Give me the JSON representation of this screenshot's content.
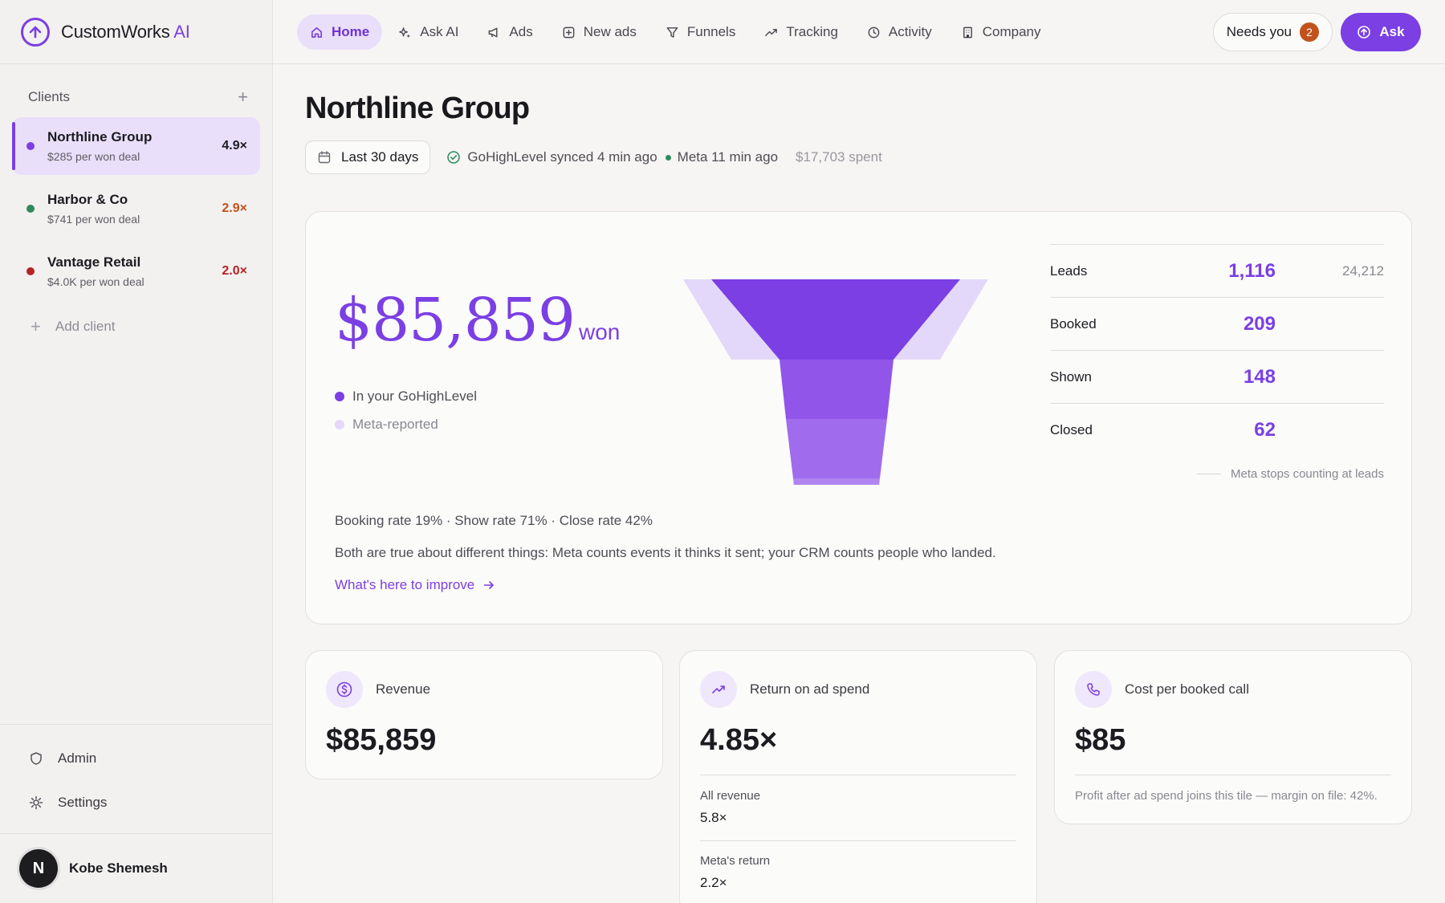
{
  "brand": {
    "name": "CustomWorks",
    "suffix": "AI"
  },
  "nav": {
    "items": [
      {
        "label": "Home",
        "icon": "home-icon",
        "active": true
      },
      {
        "label": "Ask AI",
        "icon": "sparkle-icon"
      },
      {
        "label": "Ads",
        "icon": "megaphone-icon"
      },
      {
        "label": "New ads",
        "icon": "plus-square-icon"
      },
      {
        "label": "Funnels",
        "icon": "filter-icon"
      },
      {
        "label": "Tracking",
        "icon": "trend-icon"
      },
      {
        "label": "Activity",
        "icon": "clock-icon"
      },
      {
        "label": "Company",
        "icon": "building-icon"
      }
    ],
    "needs_label": "Needs you",
    "needs_count": "2",
    "ask_label": "Ask"
  },
  "sidebar": {
    "clients_title": "Clients",
    "clients": [
      {
        "name": "Northline Group",
        "sub": "$285 per won deal",
        "ratio": "4.9×",
        "dot_color": "#7b3fe4",
        "ratio_color": "#1c1b20",
        "active": true
      },
      {
        "name": "Harbor & Co",
        "sub": "$741 per won deal",
        "ratio": "2.9×",
        "dot_color": "#2f8a5d",
        "ratio_color": "#c2521b"
      },
      {
        "name": "Vantage Retail",
        "sub": "$4.0K per won deal",
        "ratio": "2.0×",
        "dot_color": "#b42323",
        "ratio_color": "#b42323"
      }
    ],
    "add_client": "Add client",
    "admin": "Admin",
    "settings": "Settings",
    "user_initial": "N",
    "user_name": "Kobe Shemesh"
  },
  "page": {
    "title": "Northline Group",
    "range": "Last 30 days",
    "sync_ghl": "GoHighLevel synced 4 min ago",
    "sync_meta": "Meta 11 min ago",
    "spent": "$17,703 spent"
  },
  "hero": {
    "won_amount": "$85,859",
    "won_label": "won",
    "legend_ghl": "In your GoHighLevel",
    "legend_meta": "Meta-reported",
    "stats": [
      {
        "label": "Leads",
        "value": "1,116",
        "meta": "24,212"
      },
      {
        "label": "Booked",
        "value": "209",
        "meta": ""
      },
      {
        "label": "Shown",
        "value": "148",
        "meta": ""
      },
      {
        "label": "Closed",
        "value": "62",
        "meta": ""
      }
    ],
    "stats_note": "Meta stops counting at leads",
    "rates": "Booking rate 19% · Show rate 71% · Close rate 42%",
    "explain": "Both are true about different things: Meta counts events it thinks it sent; your CRM counts people who landed.",
    "improve": "What's here to improve",
    "funnel": {
      "leads": 1116,
      "booked": 209,
      "shown": 148,
      "closed": 62,
      "meta_leads": 24212
    },
    "colors": {
      "accent": "#7b3fe4",
      "meta": "#e4d8fa"
    }
  },
  "cards": {
    "revenue": {
      "title": "Revenue",
      "value": "$85,859",
      "icon": "dollar-icon"
    },
    "roas": {
      "title": "Return on ad spend",
      "value": "4.85×",
      "icon": "trend-icon",
      "all_label": "All revenue",
      "all_value": "5.8×",
      "meta_label": "Meta's return",
      "meta_value": "2.2×"
    },
    "cpbc": {
      "title": "Cost per booked call",
      "value": "$85",
      "icon": "phone-icon",
      "note": "Profit after ad spend joins this tile — margin on file: 42%."
    }
  }
}
